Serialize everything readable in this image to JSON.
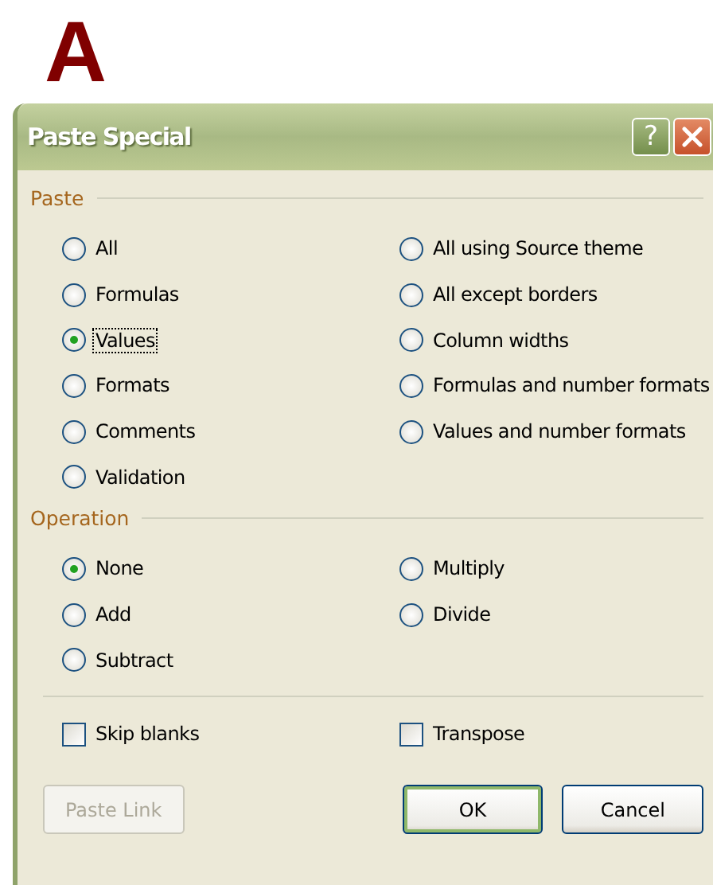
{
  "label": "A",
  "window": {
    "title": "Paste Special",
    "help_button": "?"
  },
  "paste": {
    "title": "Paste",
    "options": [
      {
        "label": "All",
        "selected": false,
        "focused": false
      },
      {
        "label": "Formulas",
        "selected": false,
        "focused": false
      },
      {
        "label": "Values",
        "selected": true,
        "focused": true
      },
      {
        "label": "Formats",
        "selected": false,
        "focused": false
      },
      {
        "label": "Comments",
        "selected": false,
        "focused": false
      },
      {
        "label": "Validation",
        "selected": false,
        "focused": false
      },
      {
        "label": "All using Source theme",
        "selected": false,
        "focused": false
      },
      {
        "label": "All except borders",
        "selected": false,
        "focused": false
      },
      {
        "label": "Column widths",
        "selected": false,
        "focused": false
      },
      {
        "label": "Formulas and number formats",
        "selected": false,
        "focused": false
      },
      {
        "label": "Values and number formats",
        "selected": false,
        "focused": false
      }
    ]
  },
  "operation": {
    "title": "Operation",
    "options": [
      {
        "label": "None",
        "selected": true,
        "focused": false
      },
      {
        "label": "Add",
        "selected": false,
        "focused": false
      },
      {
        "label": "Subtract",
        "selected": false,
        "focused": false
      },
      {
        "label": "Multiply",
        "selected": false,
        "focused": false
      },
      {
        "label": "Divide",
        "selected": false,
        "focused": false
      }
    ]
  },
  "checkboxes": [
    {
      "label": "Skip blanks",
      "checked": false
    },
    {
      "label": "Transpose",
      "checked": false
    }
  ],
  "buttons": [
    {
      "label": "Paste Link",
      "disabled": true,
      "default": false
    },
    {
      "label": "OK",
      "disabled": false,
      "default": true
    },
    {
      "label": "Cancel",
      "disabled": false,
      "default": false
    }
  ]
}
